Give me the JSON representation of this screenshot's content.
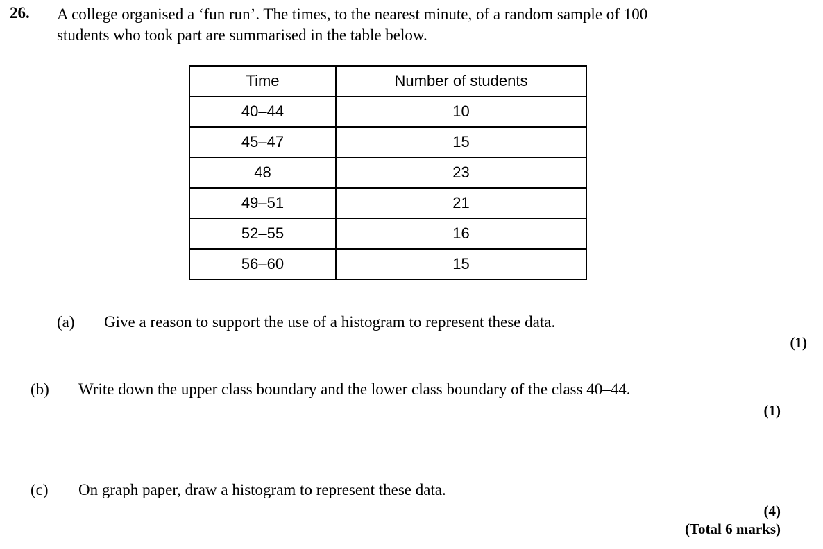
{
  "question": {
    "number": "26.",
    "intro_line1": "A college organised a ‘fun run’. The times, to the nearest minute, of a random sample of 100",
    "intro_line2": "students who took part are summarised in the table below."
  },
  "table": {
    "headers": [
      "Time",
      "Number of students"
    ],
    "rows": [
      [
        "40–44",
        "10"
      ],
      [
        "45–47",
        "15"
      ],
      [
        "48",
        "23"
      ],
      [
        "49–51",
        "21"
      ],
      [
        "52–55",
        "16"
      ],
      [
        "56–60",
        "15"
      ]
    ]
  },
  "parts": [
    {
      "label": "(a)",
      "text": "Give a reason to support the use of a histogram to represent these data.",
      "marks": "(1)"
    },
    {
      "label": "(b)",
      "text": "Write down the upper class boundary and the lower class boundary of the class 40–44.",
      "marks": "(1)"
    },
    {
      "label": "(c)",
      "text": "On graph paper, draw a histogram to represent these data.",
      "marks": "(4)"
    }
  ],
  "total_marks": "(Total 6 marks)"
}
